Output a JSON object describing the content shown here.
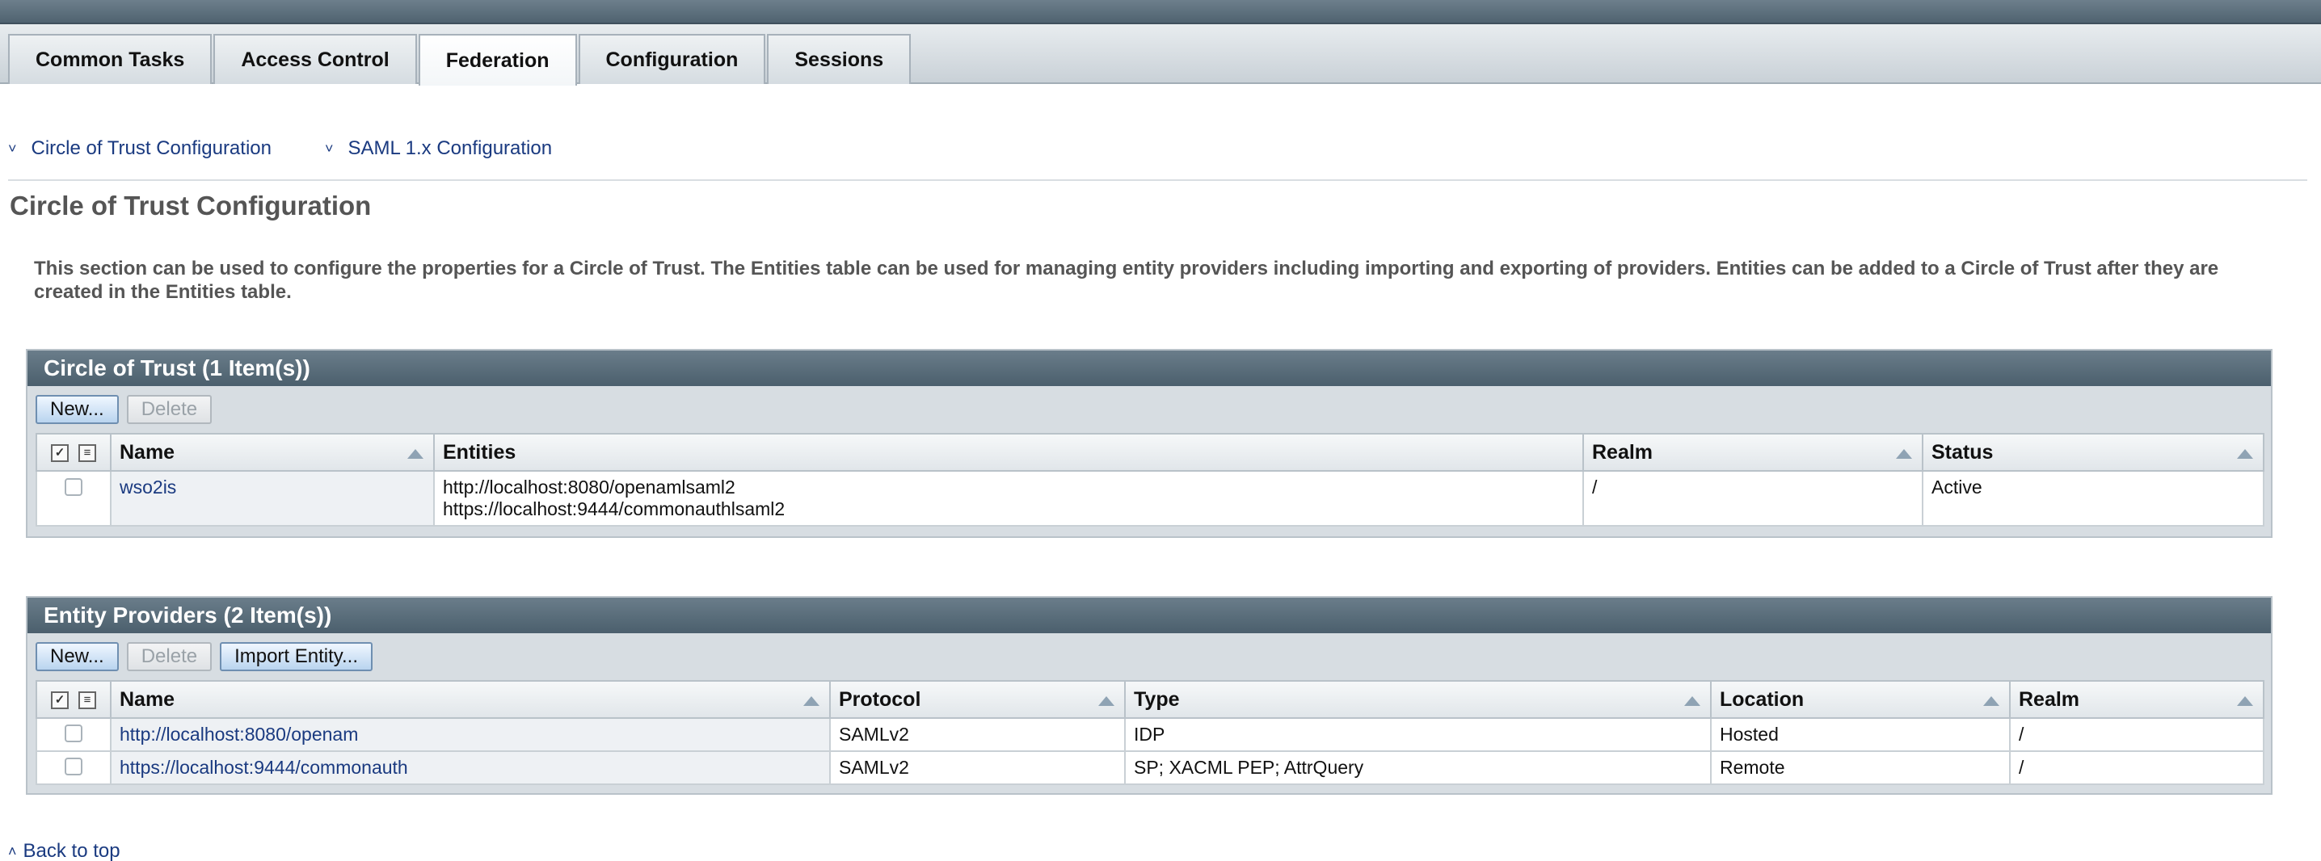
{
  "tabs": [
    "Common Tasks",
    "Access Control",
    "Federation",
    "Configuration",
    "Sessions"
  ],
  "active_tab": "Federation",
  "jump_links": [
    "Circle of Trust Configuration",
    "SAML 1.x Configuration"
  ],
  "page": {
    "title": "Circle of Trust Configuration",
    "description": "This section can be used to configure the properties for a Circle of Trust. The Entities table can be used for managing entity providers including importing and exporting of providers. Entities can be added to a Circle of Trust after they are created in the Entities table."
  },
  "cot_panel": {
    "title": "Circle of Trust (1 Item(s))",
    "buttons": {
      "new": "New...",
      "delete": "Delete"
    },
    "columns": {
      "name": "Name",
      "entities": "Entities",
      "realm": "Realm",
      "status": "Status"
    },
    "rows": [
      {
        "name": "wso2is",
        "entities": [
          "http://localhost:8080/openamlsaml2",
          "https://localhost:9444/commonauthlsaml2"
        ],
        "realm": "/",
        "status": "Active"
      }
    ]
  },
  "entity_panel": {
    "title": "Entity Providers (2 Item(s))",
    "buttons": {
      "new": "New...",
      "delete": "Delete",
      "import": "Import Entity..."
    },
    "columns": {
      "name": "Name",
      "protocol": "Protocol",
      "type": "Type",
      "location": "Location",
      "realm": "Realm"
    },
    "rows": [
      {
        "name": "http://localhost:8080/openam",
        "protocol": "SAMLv2",
        "type": "IDP",
        "location": "Hosted",
        "realm": "/"
      },
      {
        "name": "https://localhost:9444/commonauth",
        "protocol": "SAMLv2",
        "type": "SP; XACML PEP; AttrQuery",
        "location": "Remote",
        "realm": "/"
      }
    ]
  },
  "back_to_top": "Back to top",
  "colors": {
    "header_dark": "#4f6270",
    "link": "#1a3a80",
    "panel_bg": "#d7dde2"
  }
}
